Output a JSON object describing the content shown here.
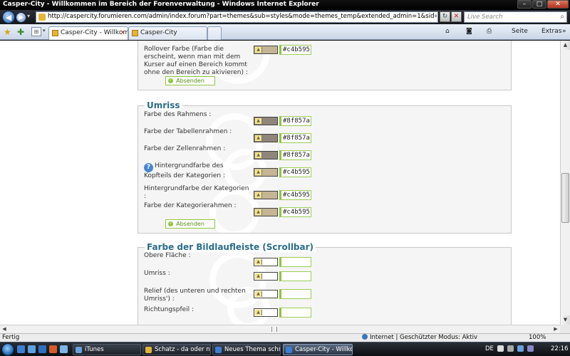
{
  "window": {
    "title": "Casper-City - Willkommen im Bereich der Forenverwaltung - Windows Internet Explorer",
    "minimize": "–",
    "maximize": "□",
    "close": "✕"
  },
  "nav": {
    "back": "◀",
    "forward": "▶",
    "url": "http://caspercity.forumieren.com/admin/index.forum?part=themes&sub=styles&mode=themes_temp&extended_admin=1&sid=236961d498c591c46fdb77352d8a",
    "refresh": "↻",
    "stop": "✕",
    "search_placeholder": "Live Search",
    "search_icon": "⌕"
  },
  "tabs": {
    "favorites_icon": "★",
    "add_favorites_icon": "✚",
    "quick_tabs_icon": "⊞",
    "active": "Casper-City - Willkomm...",
    "other": "Casper-City",
    "close": "✕",
    "commands": {
      "home": "⌂",
      "feeds": "◙",
      "print": "⎙",
      "page": "Seite",
      "tools": "Extras",
      "help": "»"
    }
  },
  "panels": {
    "rollover": {
      "label": "Rollover Farbe (Farbe die erscheint, wenn man mit dem Kurser auf einen Bereich kommt ohne den Bereich zu akivieren)  :",
      "hex": "#c4b595",
      "swatch": "#c4b595",
      "submit": "Absenden"
    },
    "umriss": {
      "legend": "Umriss",
      "rows": [
        {
          "label": "Farbe des Rahmens   :",
          "hex": "#8f857a",
          "swatch": "#8f857a",
          "help": false
        },
        {
          "label": "Farbe der Tabellenrahmen   :",
          "hex": "#8f857a",
          "swatch": "#8f857a",
          "help": false
        },
        {
          "label": "Farbe der Zellenrahmen   :",
          "hex": "#8f857a",
          "swatch": "#8f857a",
          "help": false
        },
        {
          "label": "Hintergrundfarbe des Kopfteils der Kategorien   :",
          "hex": "#c4b595",
          "swatch": "#c4b595",
          "help": true
        },
        {
          "label": "Hintergrundfarbe der Kategorien   :",
          "hex": "#c4b595",
          "swatch": "#c4b595",
          "help": false
        },
        {
          "label": "Farbe der Kategorierahmen   :",
          "hex": "#c4b595",
          "swatch": "#c4b595",
          "help": false
        }
      ],
      "submit": "Absenden"
    },
    "scrollbar": {
      "legend": "Farbe der Bildlaufleiste (Scrollbar)",
      "rows": [
        {
          "label": "Obere Fläche   :",
          "hex": "",
          "swatch": "#ffffff"
        },
        {
          "label": "Umriss   :",
          "hex": "",
          "swatch": "#ffffff"
        },
        {
          "label": "Relief (des unteren und rechten Umriss')   :",
          "hex": "",
          "swatch": "#ffffff"
        },
        {
          "label": "Richtungspfeil   :",
          "hex": "",
          "swatch": "#ffffff"
        }
      ]
    }
  },
  "status": {
    "text": "Fertig",
    "zone": "Internet | Geschützter Modus: Aktiv",
    "zoom": "100%"
  },
  "taskbar": {
    "tasks": [
      "iTunes",
      "Schatz - da oder nic...",
      "Neues Thema schrei...",
      "Casper-City - Willko..."
    ],
    "lang": "DE",
    "clock": "22:16"
  },
  "colors": {
    "accent_green": "#8dc63f",
    "legend_blue": "#2a6d8a"
  }
}
